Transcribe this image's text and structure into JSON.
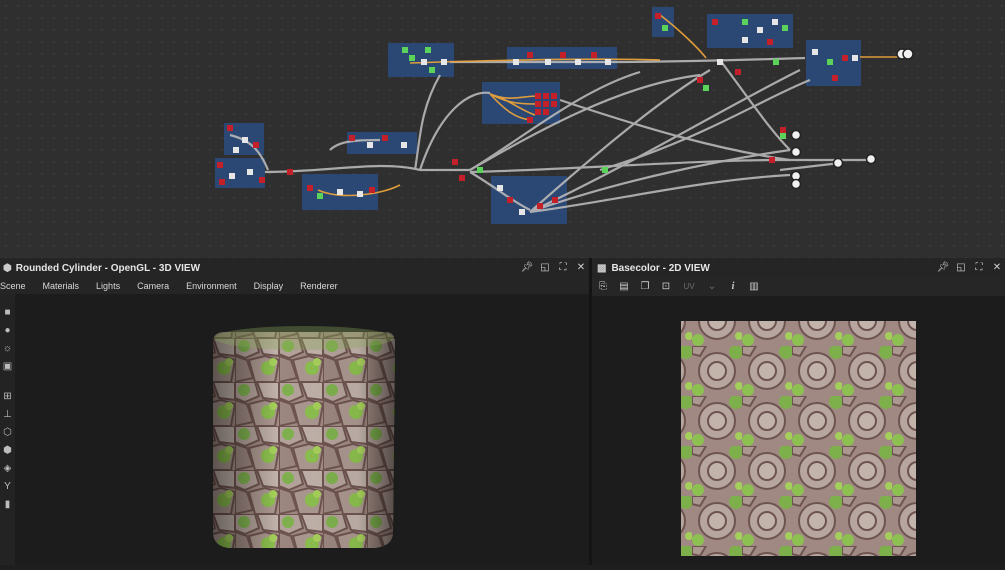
{
  "graph_view": {
    "background": "#2f2f2f"
  },
  "panel3d": {
    "title": "Rounded Cylinder - OpenGL - 3D VIEW",
    "menu": [
      "Scene",
      "Materials",
      "Lights",
      "Camera",
      "Environment",
      "Display",
      "Renderer"
    ],
    "tools": [
      "camera-icon",
      "light-bulb-icon",
      "environment-icon",
      "screenshot-icon",
      "grid-icon",
      "axis-icon",
      "cube-icon",
      "cube-outline-icon",
      "layers-icon",
      "branch-icon",
      "bar-chart-icon"
    ]
  },
  "panel2d": {
    "title": "Basecolor - 2D VIEW",
    "uv_label": "UV",
    "info_label": "i"
  },
  "colors": {
    "node_frame": "#2b4a78",
    "red_port": "#c3202a",
    "green_port": "#5bd35b",
    "link": "#b8b8b8",
    "link_orange": "#e9a23b"
  }
}
